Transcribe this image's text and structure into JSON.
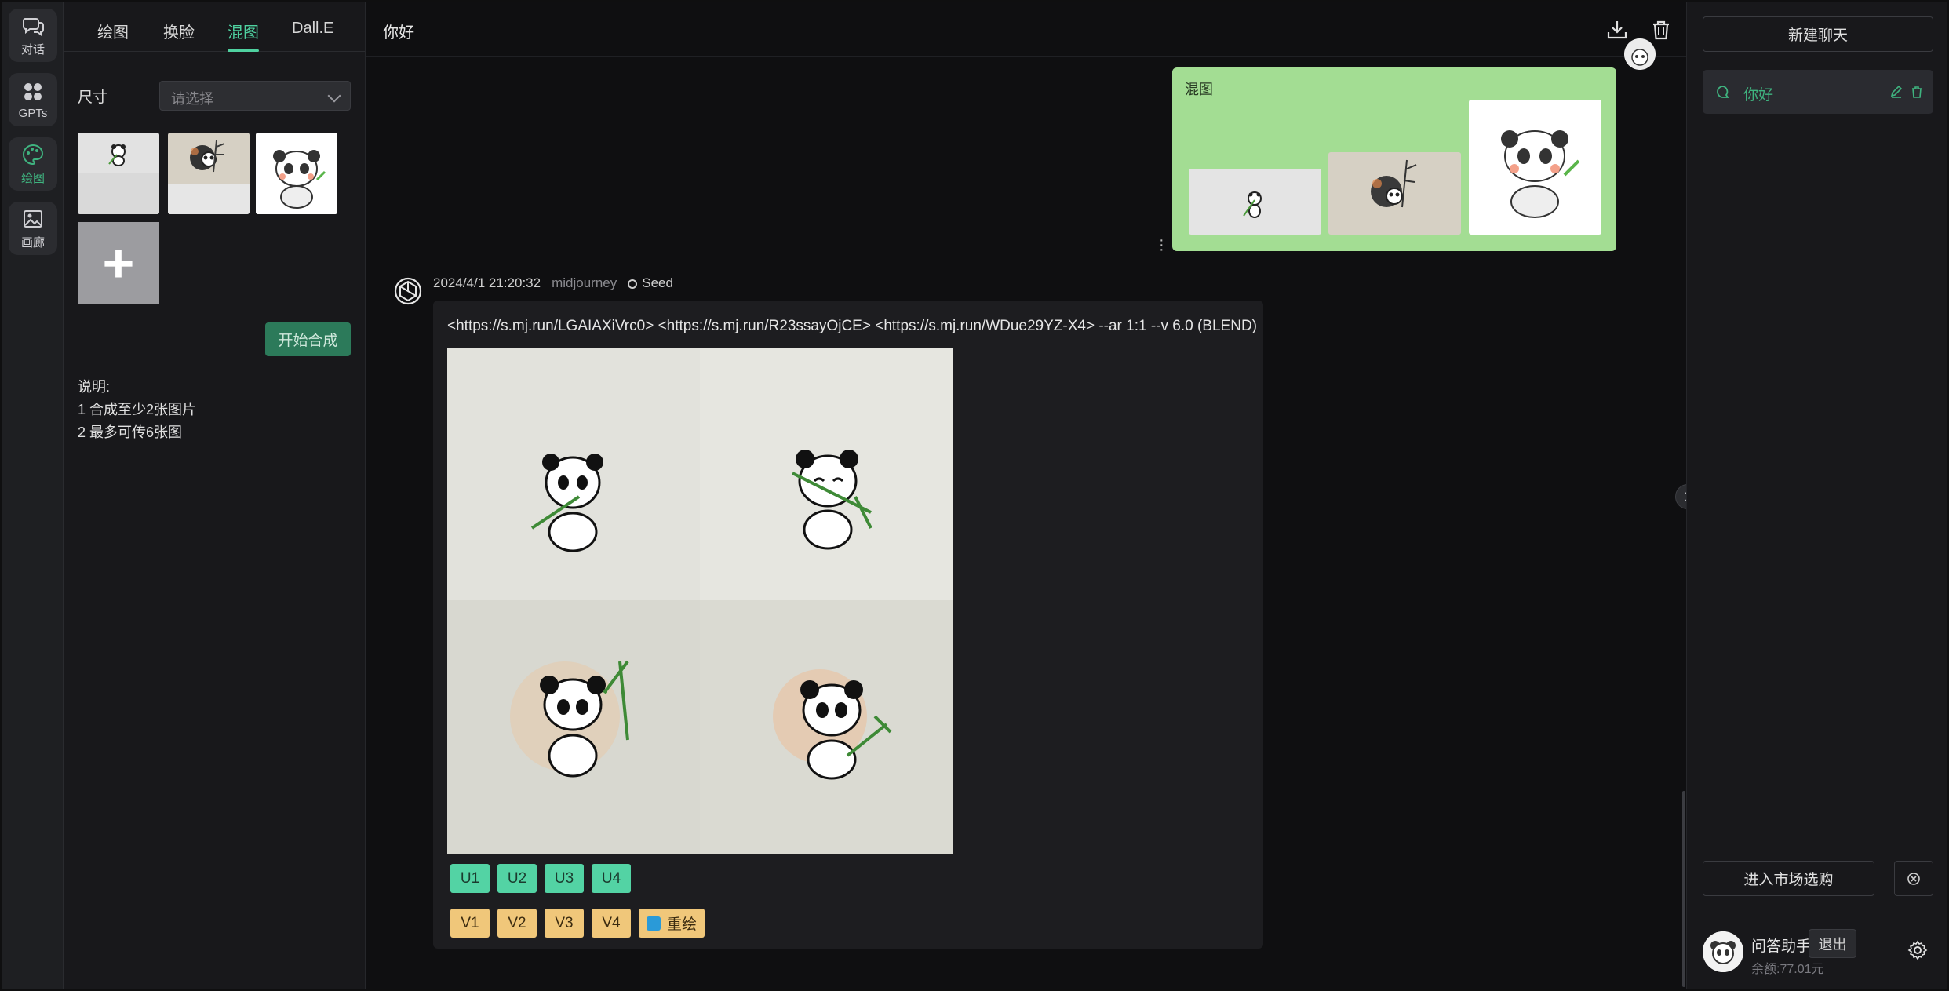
{
  "rail": [
    {
      "label": "对话",
      "icon": "chat-icon",
      "active": false
    },
    {
      "label": "GPTs",
      "icon": "apps-icon",
      "active": false
    },
    {
      "label": "绘图",
      "icon": "palette-icon",
      "active": true
    },
    {
      "label": "画廊",
      "icon": "gallery-icon",
      "active": false
    }
  ],
  "panel": {
    "tabs": [
      "绘图",
      "换脸",
      "混图",
      "Dall.E"
    ],
    "active_tab": "混图",
    "size_label": "尺寸",
    "size_placeholder": "请选择",
    "add_label": "+",
    "start_button": "开始合成",
    "notes": [
      "说明:",
      "1 合成至少2张图片",
      "2 最多可传6张图"
    ]
  },
  "main": {
    "chat_title": "你好",
    "user_message": {
      "label": "混图"
    },
    "bot_message": {
      "timestamp": "2024/4/1 21:20:32",
      "source": "midjourney",
      "seed_label": "Seed",
      "prompt": "<https://s.mj.run/LGAIAXiVrc0> <https://s.mj.run/R23ssayOjCE> <https://s.mj.run/WDue29YZ-X4> --ar 1:1 --v 6.0 (BLEND)",
      "upscale_buttons": [
        "U1",
        "U2",
        "U3",
        "U4"
      ],
      "variation_buttons": [
        "V1",
        "V2",
        "V3",
        "V4"
      ],
      "redraw_label": "重绘"
    }
  },
  "sidebar": {
    "new_chat": "新建聊天",
    "chats": [
      {
        "name": "你好"
      }
    ],
    "market_button": "进入市场选购",
    "account": {
      "name": "问答助手",
      "balance": "余额:77.01元",
      "logout": "退出"
    }
  },
  "colors": {
    "accent": "#4fd1a0",
    "user_bubble": "#a3dd93",
    "upscale_btn": "#53d3a4",
    "variation_btn": "#f0c77a"
  }
}
